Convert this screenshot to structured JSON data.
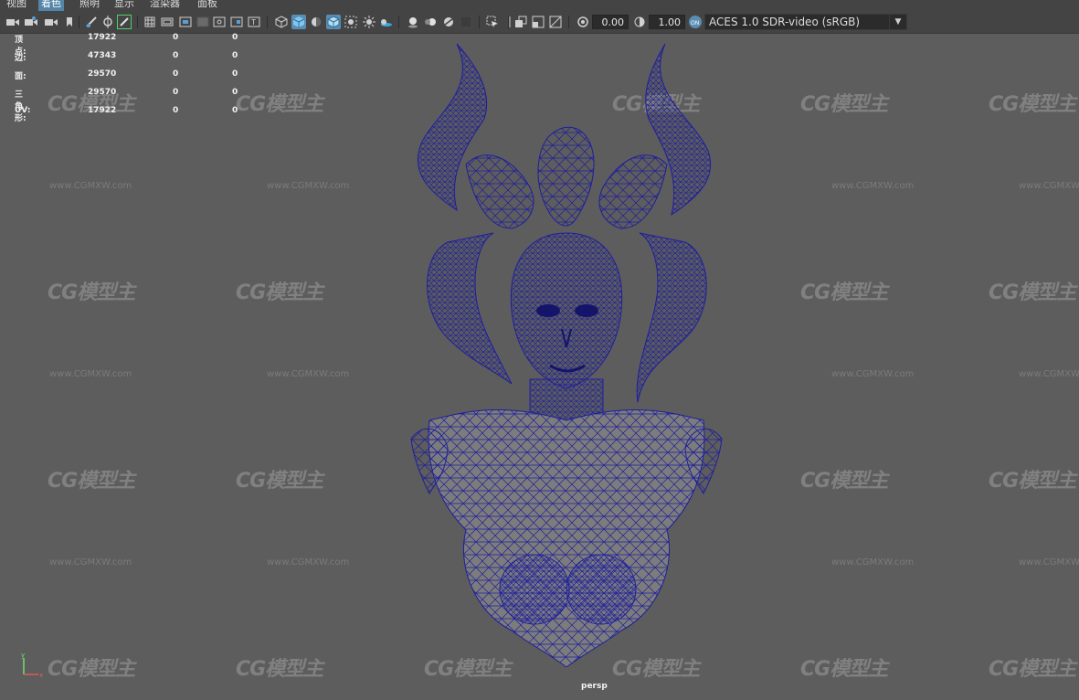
{
  "menu": {
    "items": [
      "视图",
      "着色",
      "照明",
      "显示",
      "渲染器",
      "面板"
    ],
    "active_index": 1
  },
  "toolbar": {
    "field1": "0.00",
    "field2": "1.00",
    "colorspace": "ACES 1.0 SDR-video (sRGB)"
  },
  "hud": {
    "rows": [
      {
        "label": "顶点:",
        "v1": "17922",
        "v2": "0",
        "v3": "0"
      },
      {
        "label": "边:",
        "v1": "47343",
        "v2": "0",
        "v3": "0"
      },
      {
        "label": "面:",
        "v1": "29570",
        "v2": "0",
        "v3": "0"
      },
      {
        "label": "三角形:",
        "v1": "29570",
        "v2": "0",
        "v3": "0"
      },
      {
        "label": "UV:",
        "v1": "17922",
        "v2": "0",
        "v3": "0"
      }
    ]
  },
  "viewport": {
    "camera_label": "persp",
    "axis_x": "x",
    "axis_y": "y"
  },
  "watermark": {
    "logo": "CG模型主",
    "url": "www.CGMXW.com"
  },
  "colors": {
    "viewport_bg": "#5d5d5d",
    "wire": "#1e1e9e",
    "menu_active": "#5285a6"
  }
}
